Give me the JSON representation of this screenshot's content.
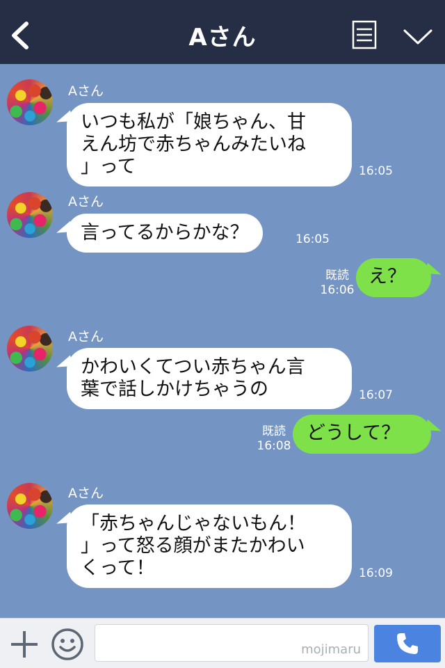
{
  "header": {
    "title": "Aさん"
  },
  "messages": [
    {
      "sender": "Aさん",
      "text": "いつも私が「娘ちゃん、甘\nえん坊で赤ちゃんみたいね\n」って",
      "time": "16:05"
    },
    {
      "sender": "Aさん",
      "text": "言ってるからかな？",
      "time": "16:05"
    },
    {
      "text": "え？",
      "read": "既読",
      "time": "16:06"
    },
    {
      "sender": "Aさん",
      "text": "かわいくてつい赤ちゃん言\n葉で話しかけちゃうの",
      "time": "16:07"
    },
    {
      "text": "どうして？",
      "read": "既読",
      "time": "16:08"
    },
    {
      "sender": "Aさん",
      "text": "「赤ちゃんじゃないもん！\n」って怒る顔がまたかわい\nくって！",
      "time": "16:09"
    }
  ],
  "input": {
    "placeholder": "",
    "watermark": "mojimaru"
  },
  "icons": {
    "back": "back-arrow-icon",
    "menu": "menu-icon",
    "chevron": "chevron-down-icon",
    "plus": "plus-icon",
    "emoji": "emoji-icon",
    "call": "phone-icon"
  },
  "colors": {
    "header_bg": "#262e45",
    "chat_bg": "#7494c3",
    "outgoing_bubble": "#7fe14a",
    "incoming_bubble": "#ffffff",
    "call_button": "#4b83e0"
  }
}
